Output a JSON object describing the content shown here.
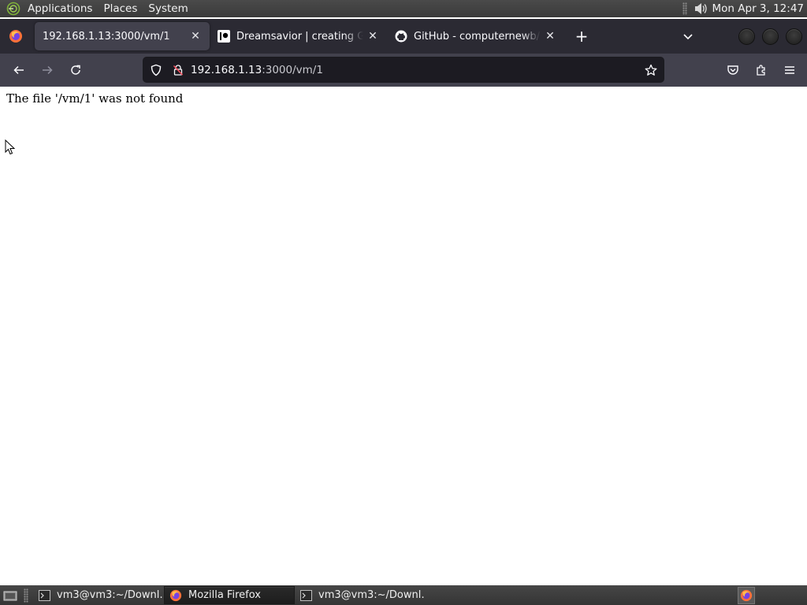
{
  "top_panel": {
    "menus": [
      "Applications",
      "Places",
      "System"
    ],
    "clock": "Mon Apr  3, 12:47",
    "icons": [
      "distro-logo-icon",
      "volume-icon"
    ]
  },
  "browser": {
    "tabs": [
      {
        "title": "192.168.1.13:3000/vm/1",
        "active": true,
        "favicon": "none"
      },
      {
        "title": "Dreamsavior | creating Games",
        "active": false,
        "favicon": "patreon-icon"
      },
      {
        "title": "GitHub - computernewb/coll",
        "active": false,
        "favicon": "github-icon"
      }
    ],
    "new_tab_glyph": "+",
    "url": {
      "host": "192.168.1.13",
      "rest": ":3000/vm/1"
    },
    "accent": "#2b2a33",
    "toolbar_color": "#42414d"
  },
  "page": {
    "message": "The file '/vm/1' was not found"
  },
  "taskbar": {
    "tasks": [
      {
        "label": "vm3@vm3:~/Downl…",
        "icon": "terminal-icon",
        "active": false
      },
      {
        "label": "Mozilla Firefox",
        "icon": "firefox-icon",
        "active": true
      },
      {
        "label": "vm3@vm3:~/Downl…",
        "icon": "terminal-icon",
        "active": false
      }
    ]
  }
}
